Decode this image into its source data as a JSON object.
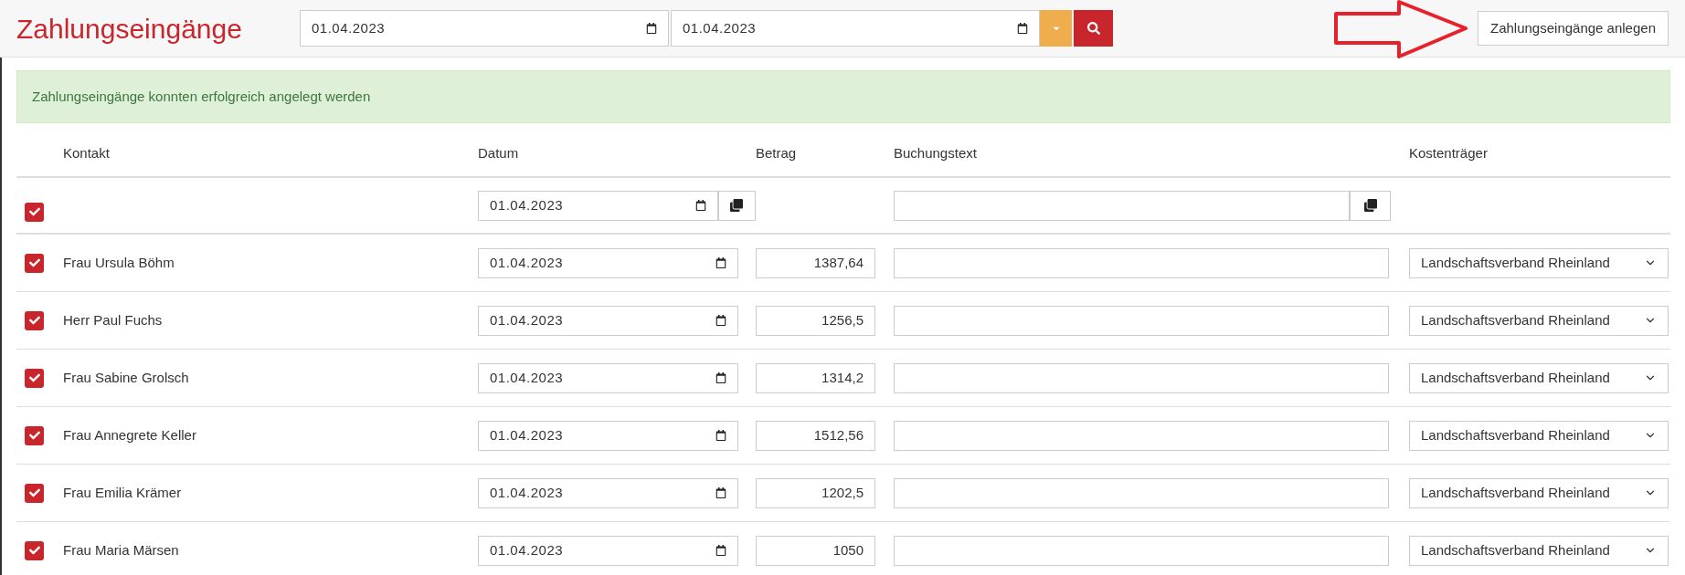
{
  "header": {
    "title": "Zahlungseingänge",
    "date_from": "01.04.2023",
    "date_to": "01.04.2023",
    "create_button": "Zahlungseingänge anlegen"
  },
  "alert": {
    "message": "Zahlungseingänge konnten erfolgreich angelegt werden"
  },
  "table": {
    "columns": [
      "Kontakt",
      "Datum",
      "Betrag",
      "Buchungstext",
      "Kostenträger"
    ],
    "bulk_row": {
      "checked": true,
      "date": "01.04.2023"
    },
    "rows": [
      {
        "checked": true,
        "contact": "Frau Ursula Böhm",
        "date": "01.04.2023",
        "amount": "1387,64",
        "cost_bearer": "Landschaftsverband Rheinland"
      },
      {
        "checked": true,
        "contact": "Herr Paul Fuchs",
        "date": "01.04.2023",
        "amount": "1256,5",
        "cost_bearer": "Landschaftsverband Rheinland"
      },
      {
        "checked": true,
        "contact": "Frau Sabine Grolsch",
        "date": "01.04.2023",
        "amount": "1314,2",
        "cost_bearer": "Landschaftsverband Rheinland"
      },
      {
        "checked": true,
        "contact": "Frau Annegrete Keller",
        "date": "01.04.2023",
        "amount": "1512,56",
        "cost_bearer": "Landschaftsverband Rheinland"
      },
      {
        "checked": true,
        "contact": "Frau Emilia Krämer",
        "date": "01.04.2023",
        "amount": "1202,5",
        "cost_bearer": "Landschaftsverband Rheinland"
      },
      {
        "checked": true,
        "contact": "Frau Maria Märsen",
        "date": "01.04.2023",
        "amount": "1050",
        "cost_bearer": "Landschaftsverband Rheinland"
      }
    ]
  }
}
